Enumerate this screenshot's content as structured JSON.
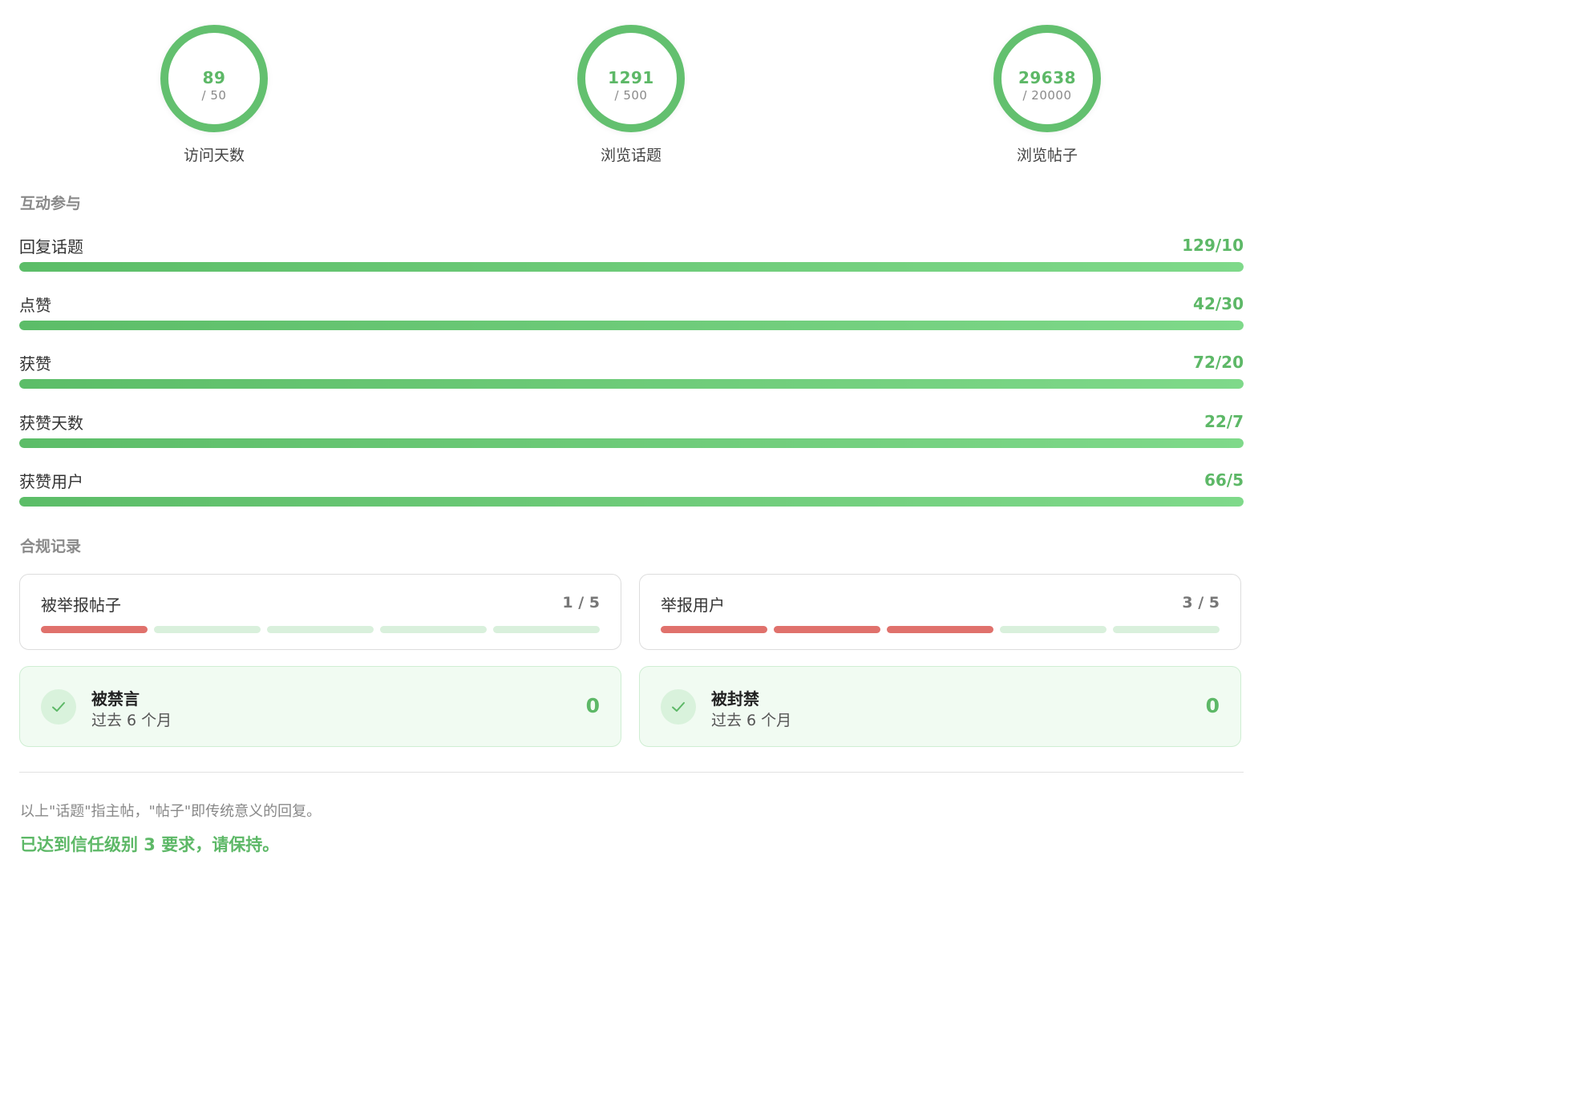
{
  "circles": [
    {
      "value": "89",
      "target": "/ 50",
      "label": "访问天数"
    },
    {
      "value": "1291",
      "target": "/ 500",
      "label": "浏览话题"
    },
    {
      "value": "29638",
      "target": "/ 20000",
      "label": "浏览帖子"
    }
  ],
  "engagement": {
    "heading": "互动参与",
    "rows": [
      {
        "label": "回复话题",
        "count": "129/10",
        "progress": 1.0
      },
      {
        "label": "点赞",
        "count": "42/30",
        "progress": 1.0
      },
      {
        "label": "获赞",
        "count": "72/20",
        "progress": 1.0
      },
      {
        "label": "获赞天数",
        "count": "22/7",
        "progress": 1.0
      },
      {
        "label": "获赞用户",
        "count": "66/5",
        "progress": 1.0
      }
    ]
  },
  "compliance": {
    "heading": "合规记录",
    "reports": [
      {
        "title": "被举报帖子",
        "count": "1 / 5",
        "filled": 1,
        "total": 5
      },
      {
        "title": "举报用户",
        "count": "3 / 5",
        "filled": 3,
        "total": 5
      }
    ],
    "statuses": [
      {
        "title": "被禁言",
        "sub": "过去 6 个月",
        "value": "0",
        "icon": "check-icon"
      },
      {
        "title": "被封禁",
        "sub": "过去 6 个月",
        "value": "0",
        "icon": "check-icon"
      }
    ]
  },
  "footer": {
    "note": "以上\"话题\"指主帖，\"帖子\"即传统意义的回复。",
    "achievement": "已达到信任级别 3 要求，请保持。"
  },
  "colors": {
    "accent": "#5db867",
    "danger": "#e0716c",
    "segment_empty": "#d9f0dc"
  }
}
